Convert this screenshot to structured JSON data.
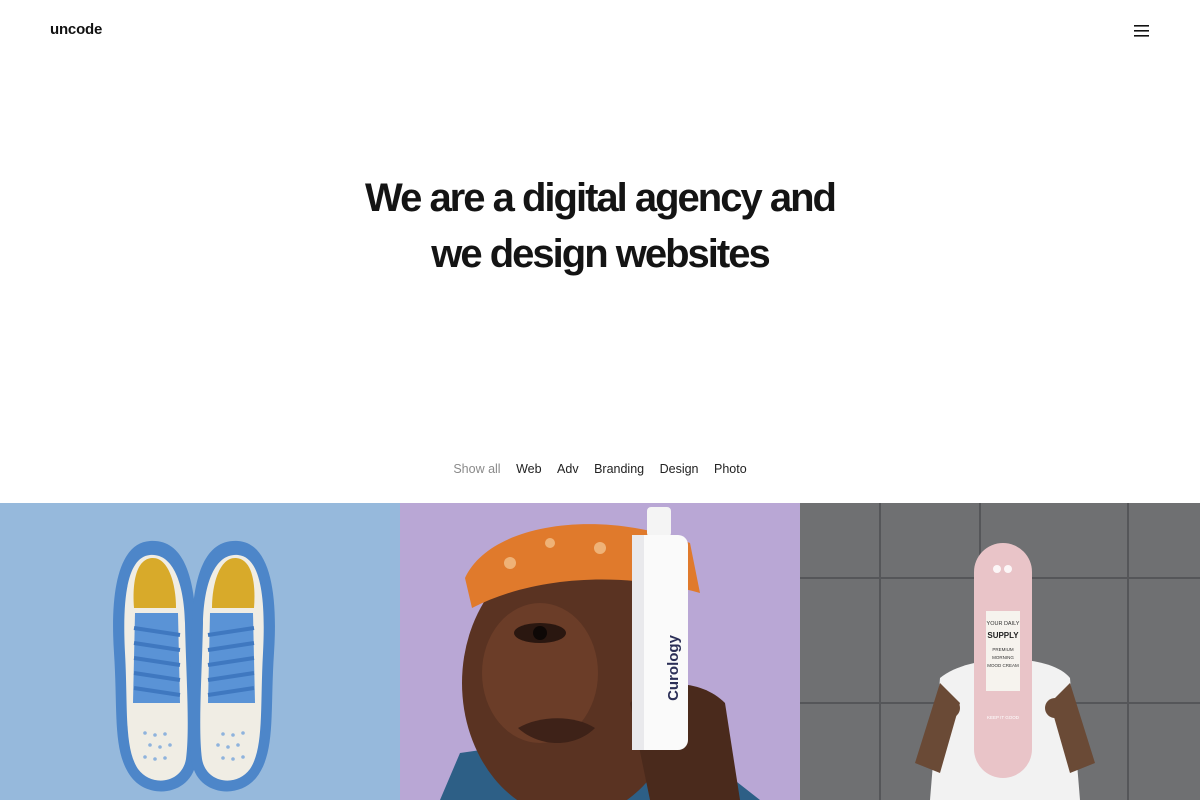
{
  "header": {
    "logo": "uncode",
    "menu_icon": "hamburger-menu-icon"
  },
  "hero": {
    "line1": "We are a digital agency and",
    "line2": "we design websites"
  },
  "filters": {
    "items": [
      "Show all",
      "Web",
      "Adv",
      "Branding",
      "Design",
      "Photo"
    ],
    "active": "Show all"
  },
  "portfolio": {
    "items": [
      {
        "subject": "sneakers",
        "background": "#96b9dc"
      },
      {
        "subject": "curology-portrait",
        "bottle_label": "Curology",
        "background": "#b9a7d5"
      },
      {
        "subject": "skateboard",
        "board_lines": [
          "YOUR DAILY",
          "SUPPLY",
          "PREMIUM",
          "MORNING",
          "MOOD CREAM",
          "KEEP IT GOOD"
        ],
        "background": "#6f7072"
      }
    ]
  }
}
